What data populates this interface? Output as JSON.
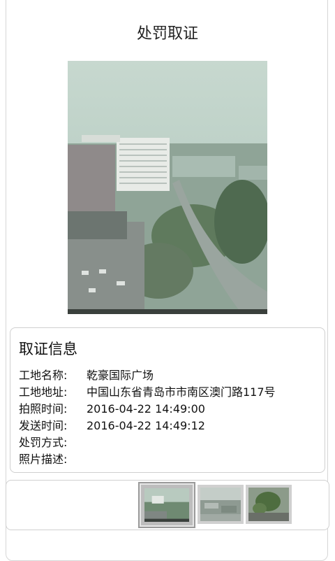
{
  "header": {
    "title": "处罚取证"
  },
  "photo": {
    "alt": "evidence-photo"
  },
  "info": {
    "title": "取证信息",
    "rows": [
      {
        "label": "工地名称:",
        "value": "乾豪国际广场"
      },
      {
        "label": "工地地址:",
        "value": "中国山东省青岛市市南区澳门路117号"
      },
      {
        "label": "拍照时间:",
        "value": "2016-04-22 14:49:00"
      },
      {
        "label": "发送时间:",
        "value": "2016-04-22 14:49:12"
      },
      {
        "label": "处罚方式:",
        "value": ""
      },
      {
        "label": "照片描述:",
        "value": ""
      }
    ]
  },
  "thumbnails": {
    "count": 3,
    "selected_index": 0
  }
}
